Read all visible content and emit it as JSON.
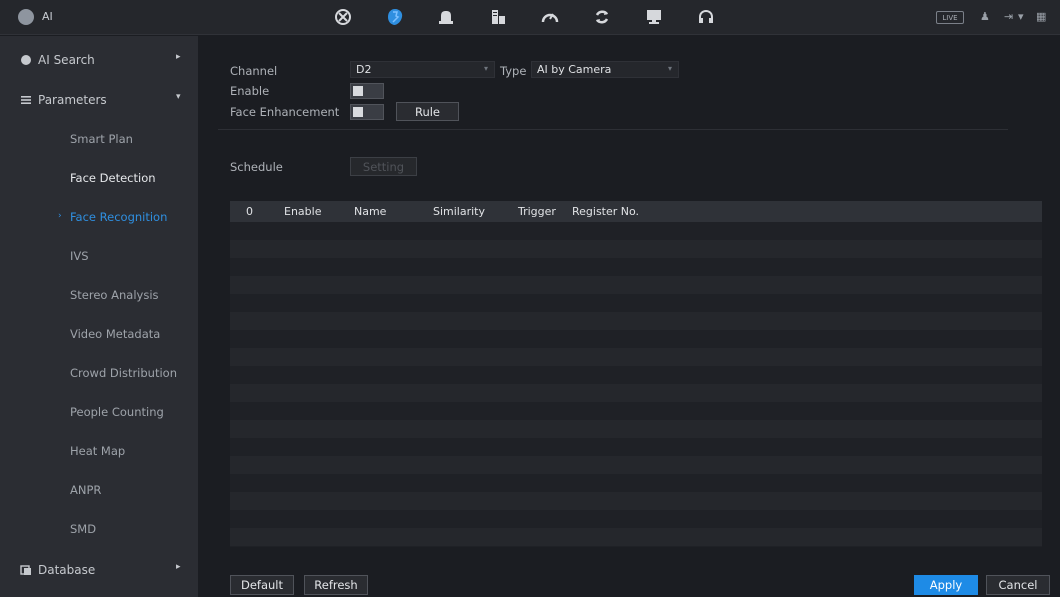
{
  "app": {
    "title": "AI",
    "live_label": "LIVE"
  },
  "topbar_icons": [
    "network-icon",
    "ai-icon",
    "alarm-icon",
    "storage-icon",
    "performance-icon",
    "backup-icon",
    "display-icon",
    "audio-icon"
  ],
  "sidebar": {
    "groups": {
      "ai_search": "AI Search",
      "parameters": "Parameters",
      "database": "Database"
    },
    "items": [
      {
        "label": "Smart Plan"
      },
      {
        "label": "Face Detection"
      },
      {
        "label": "Face Recognition"
      },
      {
        "label": "IVS"
      },
      {
        "label": "Stereo Analysis"
      },
      {
        "label": "Video Metadata"
      },
      {
        "label": "Crowd Distribution"
      },
      {
        "label": "People Counting"
      },
      {
        "label": "Heat Map"
      },
      {
        "label": "ANPR"
      },
      {
        "label": "SMD"
      }
    ],
    "active_item": "Face Recognition"
  },
  "form": {
    "channel_label": "Channel",
    "channel_value": "D2",
    "type_label": "Type",
    "type_value": "AI by Camera",
    "enable_label": "Enable",
    "face_enhancement_label": "Face Enhancement",
    "rule_button": "Rule",
    "schedule_label": "Schedule",
    "setting_button": "Setting"
  },
  "table": {
    "columns": [
      "0",
      "Enable",
      "Name",
      "Similarity",
      "Trigger",
      "Register No."
    ],
    "rows": []
  },
  "footer": {
    "default_button": "Default",
    "refresh_button": "Refresh",
    "apply_button": "Apply",
    "cancel_button": "Cancel"
  },
  "colors": {
    "accent": "#1e8be6",
    "active_text": "#2f8fe0",
    "background": "#1b1d22",
    "sidebar": "#2b2d33"
  }
}
